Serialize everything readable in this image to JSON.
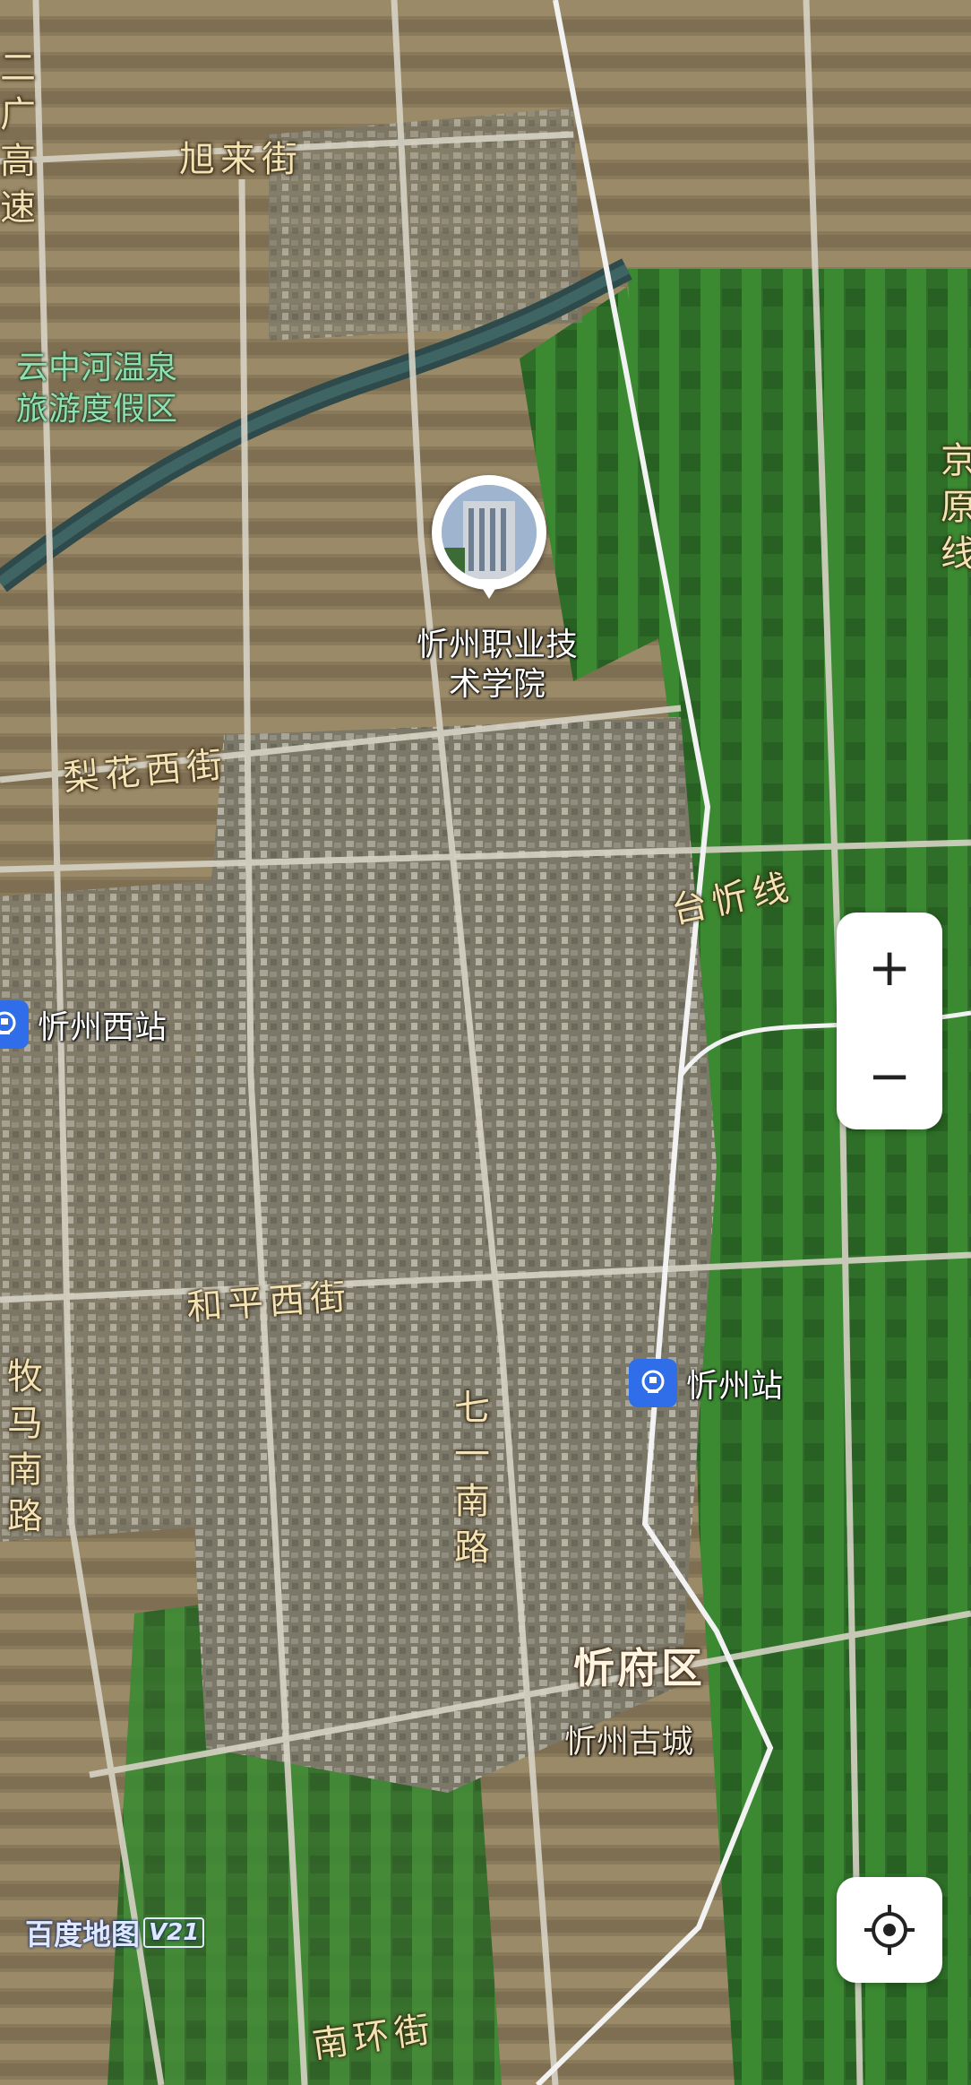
{
  "map": {
    "roads": {
      "xulai_street": "旭来街",
      "lihua_west_street": "梨花西街",
      "heping_west_street": "和平西街",
      "qiyi_south_road": "七一南路",
      "muma_south_road": "牧马南路",
      "nanhuan_street": "南环街",
      "taixin_line": "台忻线",
      "erguang_expressway": "二广高速",
      "jingyuan_line": "京原线"
    },
    "areas": {
      "resort": "云中河温泉旅游度假区",
      "district": "忻府区",
      "ancient_city": "忻州古城"
    },
    "poi": {
      "college": "忻州职业技术学院"
    },
    "stations": {
      "west": "忻州西站",
      "main": "忻州站"
    }
  },
  "controls": {
    "zoom_in": "+",
    "zoom_out": "−"
  },
  "logo": {
    "name": "百度地图",
    "version": "V21"
  },
  "colors": {
    "station_blue": "#2f6ee8",
    "farmland_green": "#2f7a2a",
    "road_label": "#f3e3b4"
  },
  "icons": {
    "station": "railway-station-icon",
    "locate": "locate-icon"
  }
}
